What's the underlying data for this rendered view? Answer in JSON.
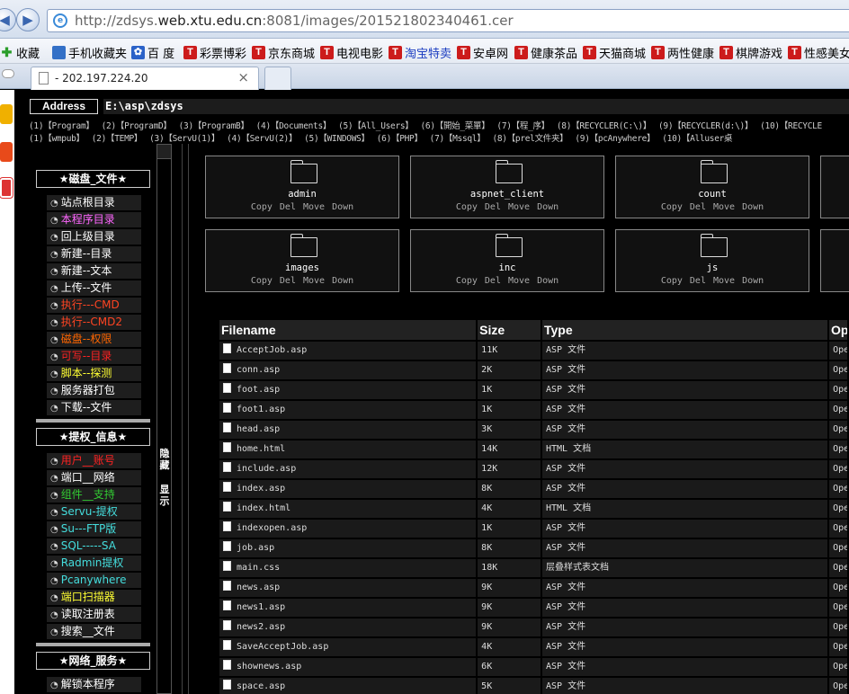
{
  "browser": {
    "url_prefix": "http://zdsys.",
    "url_host": "web.xtu.edu.cn",
    "url_suffix": ":8081/images/201521802340461.cer",
    "favorites": [
      {
        "label": "收藏",
        "icon": "green-star-icon"
      },
      {
        "label": "手机收藏夹",
        "icon": "phone-icon"
      },
      {
        "label": "百 度",
        "icon": "baidu-paw-icon"
      },
      {
        "label": "彩票博彩",
        "icon": "T"
      },
      {
        "label": "京东商城",
        "icon": "T"
      },
      {
        "label": "电视电影",
        "icon": "T"
      },
      {
        "label": "淘宝特卖",
        "icon": "T"
      },
      {
        "label": "安卓网",
        "icon": "T"
      },
      {
        "label": "健康茶品",
        "icon": "T"
      },
      {
        "label": "天猫商城",
        "icon": "T"
      },
      {
        "label": "两性健康",
        "icon": "T"
      },
      {
        "label": "棋牌游戏",
        "icon": "T"
      },
      {
        "label": "性感美女",
        "icon": "T"
      }
    ],
    "tab_title": "- 202.197.224.20",
    "tab_close": "×"
  },
  "address": {
    "label": "Address",
    "value": "E:\\asp\\zdsys"
  },
  "quick_rows": [
    [
      "(1)【Program】",
      "(2)【ProgramD】",
      "(3)【ProgramB】",
      "(4)【Documents】",
      "(5)【All_Users】",
      "(6)【開始_菜單】",
      "(7)【程_序】",
      "(8)【RECYCLER(C:\\)】",
      "(9)【RECYCLER(d:\\)】",
      "(10)【RECYCLE"
    ],
    [
      "(1)【wmpub】",
      "(2)【TEMP】",
      "(3)【ServU(1)】",
      "(4)【ServU(2)】",
      "(5)【WINDOWS】",
      "(6)【PHP】",
      "(7)【Mssql】",
      "(8)【prel文件夹】",
      "(9)【pcAnywhere】",
      "(10)【Alluser桌"
    ]
  ],
  "sidebar": {
    "sections": [
      {
        "title": "★磁盘_文件★",
        "items": [
          {
            "label": "站点根目录",
            "color": "#ffffff"
          },
          {
            "label": "本程序目录",
            "color": "#ff66ff"
          },
          {
            "label": "回上级目录",
            "color": "#ffffff"
          },
          {
            "label": "新建--目录",
            "color": "#ffffff"
          },
          {
            "label": "新建--文本",
            "color": "#ffffff"
          },
          {
            "label": "上传--文件",
            "color": "#ffffff"
          },
          {
            "label": "执行---CMD",
            "color": "#ff4422"
          },
          {
            "label": "执行--CMD2",
            "color": "#ff4422"
          },
          {
            "label": "磁盘--权限",
            "color": "#ff6600"
          },
          {
            "label": "可写--目录",
            "color": "#ff2222"
          },
          {
            "label": "脚本--探测",
            "color": "#ffff33"
          },
          {
            "label": "服务器打包",
            "color": "#ffffff"
          },
          {
            "label": "下载--文件",
            "color": "#ffffff"
          }
        ]
      },
      {
        "title": "★提权_信息★",
        "items": [
          {
            "label": "用户__账号",
            "color": "#ff2222"
          },
          {
            "label": "端口__网络",
            "color": "#ffffff"
          },
          {
            "label": "组件__支持",
            "color": "#33cc33"
          },
          {
            "label": "Servu-提权",
            "color": "#44dddd"
          },
          {
            "label": "Su---FTP版",
            "color": "#44dddd"
          },
          {
            "label": "SQL-----SA",
            "color": "#44dddd"
          },
          {
            "label": "Radmin提权",
            "color": "#44dddd"
          },
          {
            "label": "Pcanywhere",
            "color": "#44dddd"
          },
          {
            "label": "端口扫描器",
            "color": "#ffff33"
          },
          {
            "label": "读取注册表",
            "color": "#ffffff"
          },
          {
            "label": "搜索__文件",
            "color": "#ffffff"
          }
        ]
      },
      {
        "title": "★网络_服务★",
        "items": [
          {
            "label": "解锁本程序",
            "color": "#ffffff"
          }
        ]
      }
    ]
  },
  "hide_toggle": {
    "hide": "隐藏",
    "show": "显示"
  },
  "folders": [
    {
      "name": "admin",
      "ops": "Copy Del Move Down"
    },
    {
      "name": "aspnet_client",
      "ops": "Copy Del Move Down"
    },
    {
      "name": "count",
      "ops": "Copy Del Move Down"
    },
    {
      "name": "images",
      "ops": "Copy Del Move Down"
    },
    {
      "name": "inc",
      "ops": "Copy Del Move Down"
    },
    {
      "name": "js",
      "ops": "Copy Del Move Down"
    }
  ],
  "files_table": {
    "headers": [
      "Filename",
      "Size",
      "Type",
      "Op"
    ],
    "op_label": "Ope",
    "rows": [
      {
        "name": "AcceptJob.asp",
        "size": "11K",
        "type": "ASP 文件"
      },
      {
        "name": "conn.asp",
        "size": "2K",
        "type": "ASP 文件"
      },
      {
        "name": "foot.asp",
        "size": "1K",
        "type": "ASP 文件"
      },
      {
        "name": "foot1.asp",
        "size": "1K",
        "type": "ASP 文件"
      },
      {
        "name": "head.asp",
        "size": "3K",
        "type": "ASP 文件"
      },
      {
        "name": "home.html",
        "size": "14K",
        "type": "HTML 文档"
      },
      {
        "name": "include.asp",
        "size": "12K",
        "type": "ASP 文件"
      },
      {
        "name": "index.asp",
        "size": "8K",
        "type": "ASP 文件"
      },
      {
        "name": "index.html",
        "size": "4K",
        "type": "HTML 文档"
      },
      {
        "name": "indexopen.asp",
        "size": "1K",
        "type": "ASP 文件"
      },
      {
        "name": "job.asp",
        "size": "8K",
        "type": "ASP 文件"
      },
      {
        "name": "main.css",
        "size": "18K",
        "type": "层叠样式表文档"
      },
      {
        "name": "news.asp",
        "size": "9K",
        "type": "ASP 文件"
      },
      {
        "name": "news1.asp",
        "size": "9K",
        "type": "ASP 文件"
      },
      {
        "name": "news2.asp",
        "size": "9K",
        "type": "ASP 文件"
      },
      {
        "name": "SaveAcceptJob.asp",
        "size": "4K",
        "type": "ASP 文件"
      },
      {
        "name": "shownews.asp",
        "size": "6K",
        "type": "ASP 文件"
      },
      {
        "name": "space.asp",
        "size": "5K",
        "type": "ASP 文件"
      }
    ]
  }
}
